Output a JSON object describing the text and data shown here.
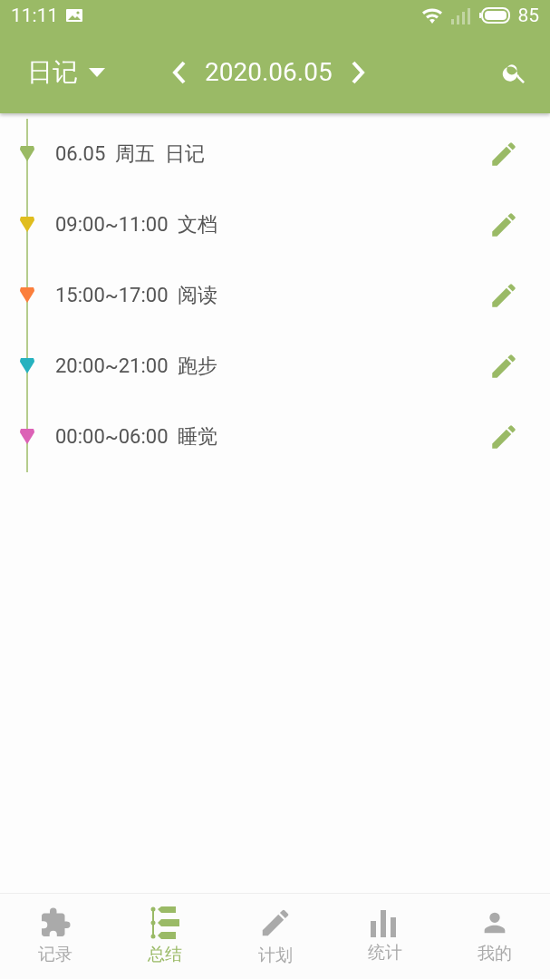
{
  "status_bar": {
    "time": "11:11",
    "battery": "85"
  },
  "toolbar": {
    "category": "日记",
    "date": "2020.06.05"
  },
  "entries": [
    {
      "text": "06.05  周五  日记",
      "color": "#9aba64"
    },
    {
      "text": "09:00~11:00  文档",
      "color": "#e0bd1e"
    },
    {
      "text": "15:00~17:00  阅读",
      "color": "#fb7f3c"
    },
    {
      "text": "20:00~21:00  跑步",
      "color": "#26b2bf"
    },
    {
      "text": "00:00~06:00  睡觉",
      "color": "#dc62b6"
    }
  ],
  "nav": [
    {
      "label": "记录",
      "kind": "puzzle",
      "selected": false
    },
    {
      "label": "总结",
      "kind": "timeline",
      "selected": true
    },
    {
      "label": "计划",
      "kind": "pencil",
      "selected": false
    },
    {
      "label": "统计",
      "kind": "bars",
      "selected": false
    },
    {
      "label": "我的",
      "kind": "person",
      "selected": false
    }
  ]
}
